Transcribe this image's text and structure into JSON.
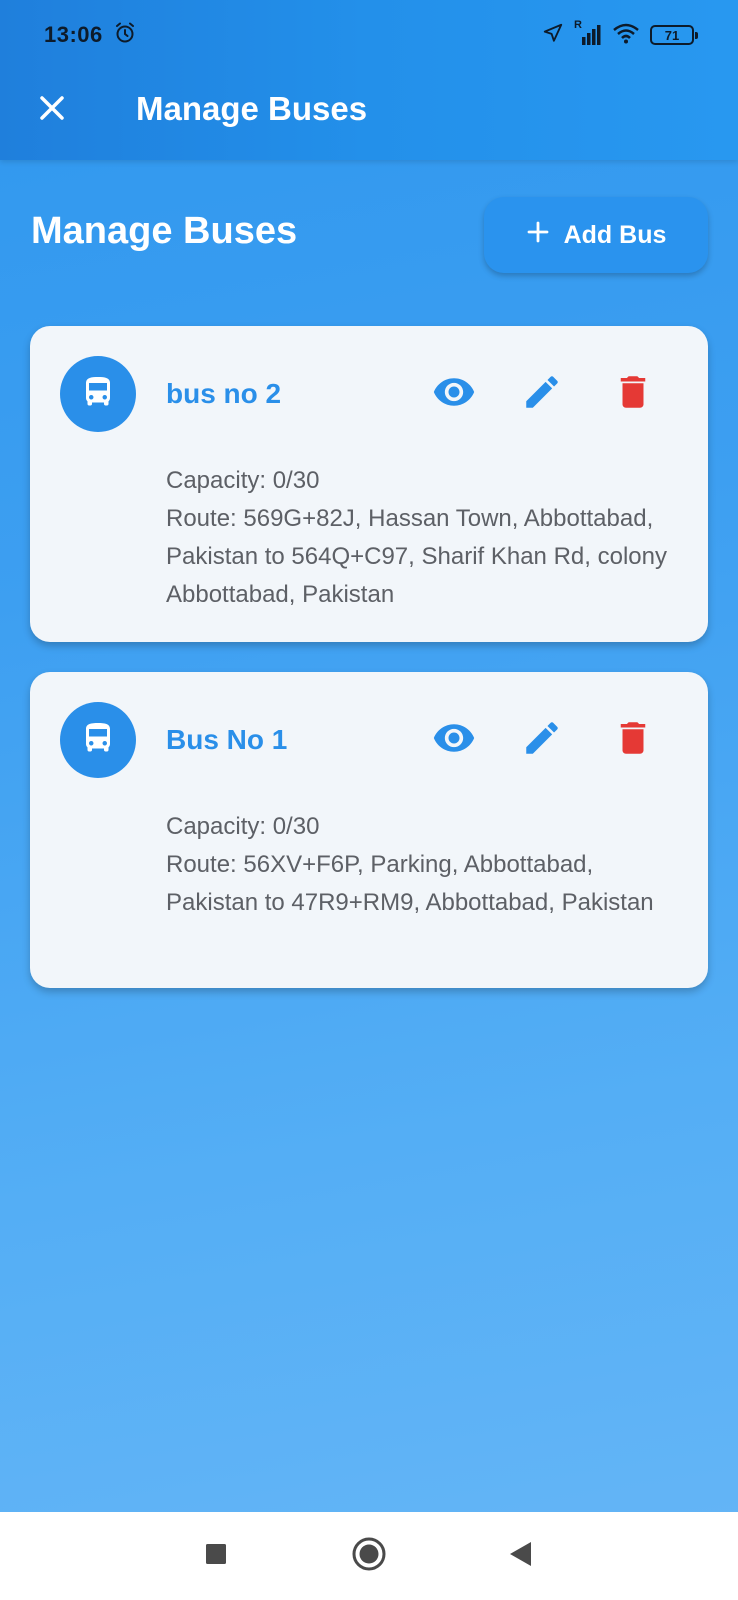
{
  "status_bar": {
    "time": "13:06",
    "battery": "71",
    "network_label": "R"
  },
  "toolbar": {
    "title": "Manage Buses",
    "close_icon": "close-icon"
  },
  "page": {
    "heading": "Manage Buses",
    "add_button_label": "Add Bus"
  },
  "buses": [
    {
      "name": "bus no 2",
      "capacity": "Capacity: 0/30",
      "route": "Route: 569G+82J, Hassan Town, Abbottabad, Pakistan to 564Q+C97, Sharif Khan Rd, colony Abbottabad, Pakistan"
    },
    {
      "name": "Bus No 1",
      "capacity": "Capacity: 0/30",
      "route": "Route: 56XV+F6P, Parking, Abbottabad, Pakistan to 47R9+RM9, Abbottabad, Pakistan"
    }
  ],
  "colors": {
    "accent": "#2a8fe9",
    "delete": "#e53935",
    "card_bg": "#f2f6fa",
    "text_muted": "#5d6066"
  },
  "icons": {
    "bus": "bus-icon",
    "view": "eye-icon",
    "edit": "pencil-icon",
    "delete": "trash-icon"
  }
}
